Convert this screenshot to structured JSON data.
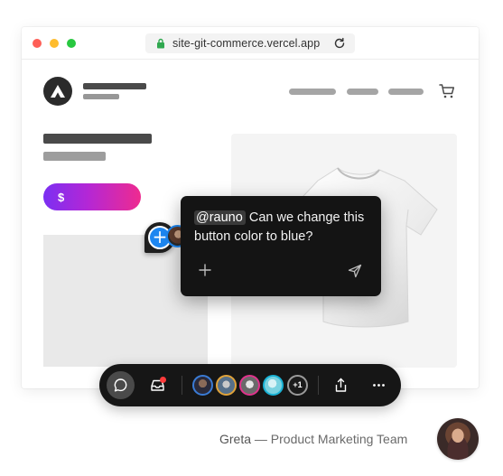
{
  "browser": {
    "url": "site-git-commerce.vercel.app"
  },
  "store": {
    "pay_button_label": "$"
  },
  "comment": {
    "mention": "@rauno",
    "text": "Can we change this button color to blue?"
  },
  "toolbar": {
    "extra_collaborators": "+1",
    "avatar_ring_colors": [
      "#3a7bd5",
      "#e0a33a",
      "#e0338c",
      "#19b3d6"
    ]
  },
  "attribution": {
    "name": "Greta",
    "separator": "—",
    "role": "Product Marketing Team"
  },
  "colors": {
    "cursor_pin": "#1d86f0",
    "notification": "#ff3b3b",
    "gradient_start": "#7b2ff2",
    "gradient_end": "#ee2b8f"
  }
}
